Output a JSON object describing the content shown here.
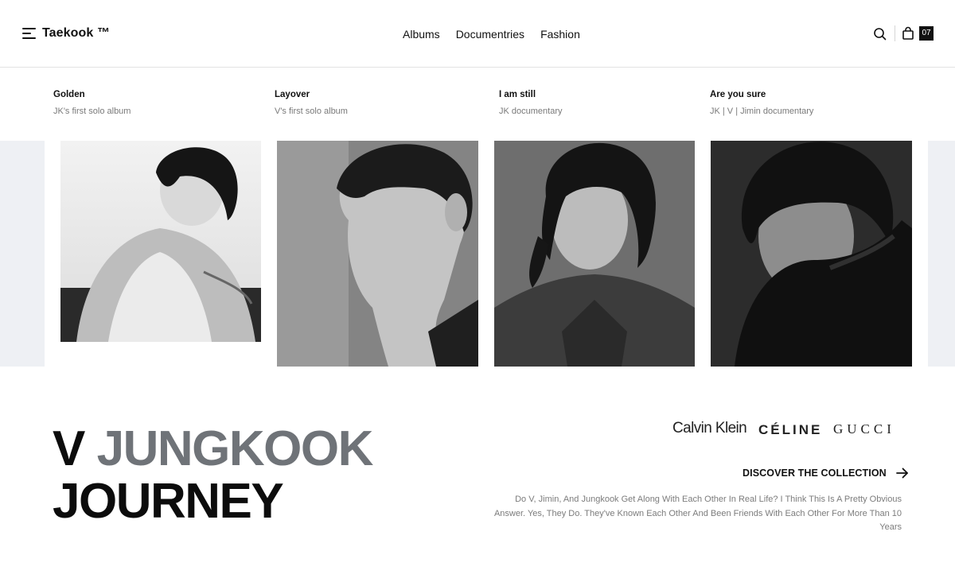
{
  "header": {
    "brand": "Taekook ™",
    "nav": [
      "Albums",
      "Documentries",
      "Fashion"
    ],
    "cart_count": "07",
    "icons": {
      "menu": "hamburger-menu-icon",
      "search": "search-icon",
      "cart": "shopping-bag-icon"
    }
  },
  "products": [
    {
      "title": "Golden",
      "subtitle": "JK's first solo album"
    },
    {
      "title": "Layover",
      "subtitle": "V's first solo album"
    },
    {
      "title": "I am still",
      "subtitle": "JK documentary"
    },
    {
      "title": "Are you sure",
      "subtitle": "JK | V | Jimin documentary"
    }
  ],
  "hero": {
    "word1": "V",
    "word2": "JUNGKOOK",
    "word3": "JOURNEY"
  },
  "brands": [
    "Calvin Klein",
    "CÉLINE",
    "GUCCI"
  ],
  "cta": {
    "label": "DISCOVER THE COLLECTION",
    "icon": "arrow-right-icon"
  },
  "description": "Do V, Jimin, And Jungkook Get Along With Each Other In Real Life? I Think This Is A Pretty Obvious Answer. Yes, They Do. They've Known Each Other And Been Friends With Each Other For More Than 10 Years",
  "colors": {
    "accent_gray": "#6f7378",
    "band": "#eef0f4",
    "text": "#111111"
  }
}
